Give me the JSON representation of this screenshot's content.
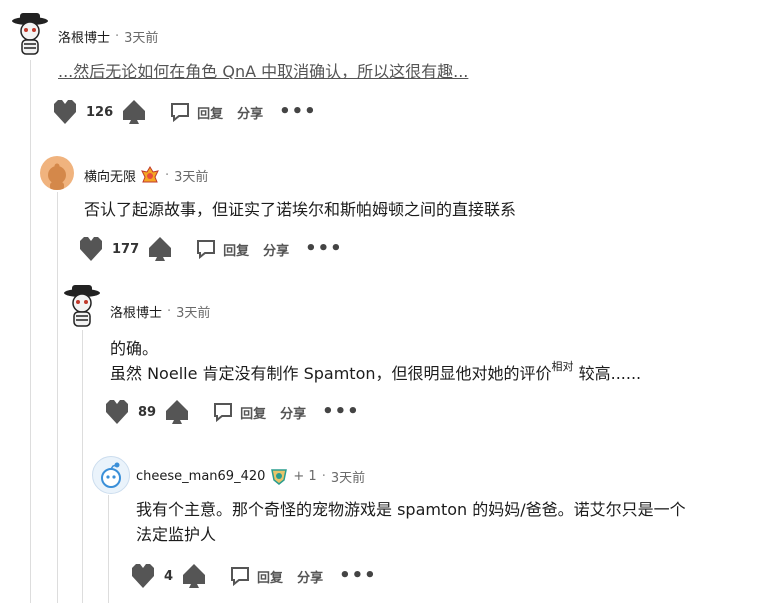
{
  "comments": [
    {
      "author": "洛根博士",
      "time": "3天前",
      "body": "...然后无论如何在角色 QnA 中取消确认，所以这很有趣...",
      "votes": "126",
      "reply_label": "回复",
      "share_label": "分享",
      "more": "•••"
    },
    {
      "author": "横向无限",
      "time": "3天前",
      "body": "否认了起源故事，但证实了诺埃尔和斯帕姆顿之间的直接联系",
      "votes": "177",
      "reply_label": "回复",
      "share_label": "分享",
      "more": "•••"
    },
    {
      "author": "洛根博士",
      "time": "3天前",
      "body_line1": "的确。",
      "body_line2_pre": "虽然 Noelle 肯定没有制作 Spamton，但很明显他对她的评价",
      "body_line2_sup": "相对",
      "body_line2_post": " 较高......",
      "votes": "89",
      "reply_label": "回复",
      "share_label": "分享",
      "more": "•••"
    },
    {
      "author": "cheese_man69_420",
      "karma": "+ 1",
      "time": "3天前",
      "body_line1": "我有个主意。那个奇怪的宠物游戏是 spamton 的妈妈/爸爸。诺艾尔只是一个",
      "body_line2": "法定监护人",
      "votes": "4",
      "reply_label": "回复",
      "share_label": "分享",
      "more": "•••"
    }
  ],
  "separator": "·",
  "colors": {
    "vote_gray": "#555555",
    "thread_line": "#dddddd",
    "meta_gray": "#6a6a6a"
  }
}
